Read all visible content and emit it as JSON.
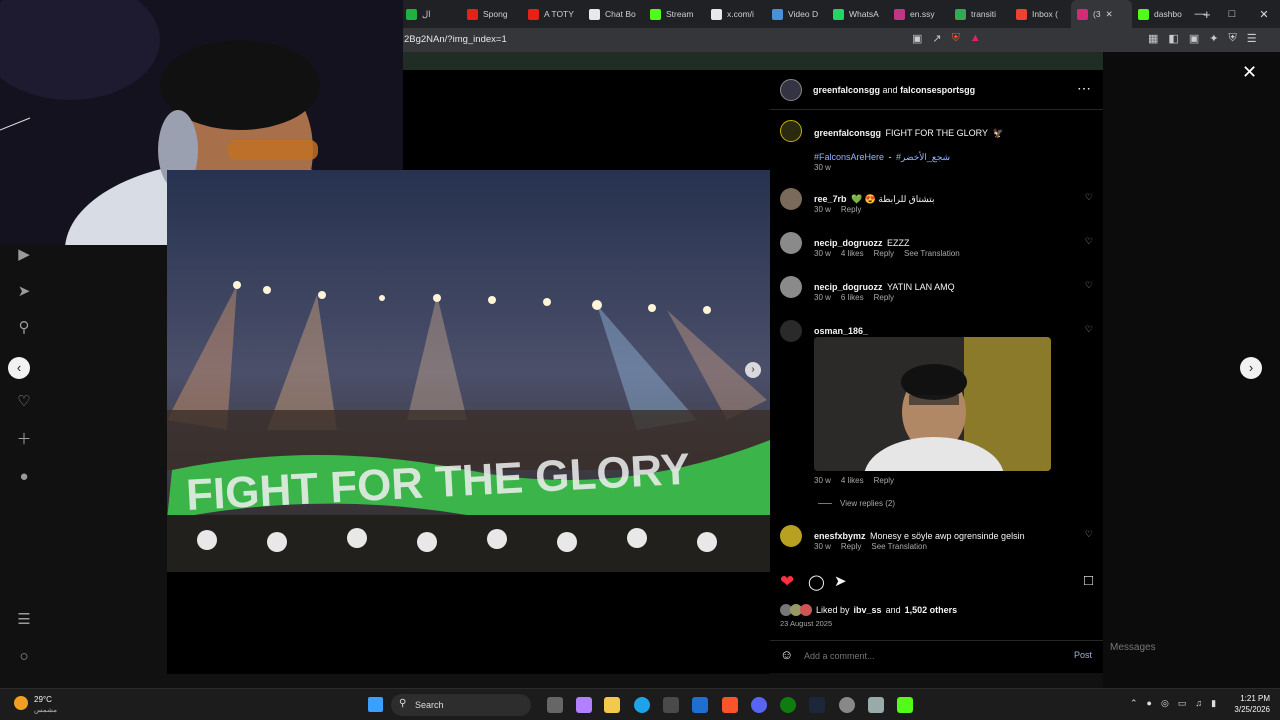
{
  "browser": {
    "tabs": [
      {
        "label": "ال",
        "color": "#1fb141"
      },
      {
        "label": "Spong",
        "color": "#e62117"
      },
      {
        "label": "A TOTY",
        "color": "#e62117"
      },
      {
        "label": "Chat Bo",
        "color": "#e8e8e8"
      },
      {
        "label": "Stream",
        "color": "#53fc18"
      },
      {
        "label": "x.com/i",
        "color": "#e8e8e8"
      },
      {
        "label": "Video D",
        "color": "#4a90d9"
      },
      {
        "label": "WhatsA",
        "color": "#25d366"
      },
      {
        "label": "en.ssy",
        "color": "#c13584"
      },
      {
        "label": "transiti",
        "color": "#34a853"
      },
      {
        "label": "Inbox (",
        "color": "#ea4335"
      },
      {
        "label": "(3",
        "color": "#d62976",
        "active": true
      },
      {
        "label": "dashbo",
        "color": "#53fc18"
      }
    ],
    "new_tab": "+",
    "url": "2Bg2NAn/?img_index=1"
  },
  "post": {
    "header": {
      "user1": "greenfalconsgg",
      "joiner": "and",
      "user2": "falconsesportsgg"
    },
    "caption": {
      "user": "greenfalconsgg",
      "text": "FIGHT FOR THE GLORY",
      "emoji": "🦅",
      "hashtag1": "#FalconsAreHere",
      "dash": "-",
      "hashtag2": "#شجع_الأخضر",
      "time": "30 w"
    },
    "banner_text": "FIGHT FOR THE GLORY",
    "comments": [
      {
        "user": "ree_7rb",
        "text": "💚 😍 بتشتاق للرابطة",
        "time": "30 w",
        "likes": "",
        "reply": "Reply",
        "translate": ""
      },
      {
        "user": "necip_dogruozz",
        "text": "EZZZ",
        "time": "30 w",
        "likes": "4 likes",
        "reply": "Reply",
        "translate": "See Translation"
      },
      {
        "user": "necip_dogruozz",
        "text": "YATIN LAN AMQ",
        "time": "30 w",
        "likes": "6 likes",
        "reply": "Reply",
        "translate": ""
      },
      {
        "user": "osman_186_",
        "text": "",
        "time": "30 w",
        "likes": "4 likes",
        "reply": "Reply",
        "translate": "",
        "view_replies": "View replies (2)"
      },
      {
        "user": "enesfxbymz",
        "text": "Monesy e söyle awp ogrensinde gelsin",
        "time": "30 w",
        "likes": "",
        "reply": "Reply",
        "translate": "See Translation"
      }
    ],
    "liked_by": {
      "prefix": "Liked by",
      "user": "ibv_ss",
      "joiner": "and",
      "others": "1,502 others"
    },
    "date": "23 August 2025",
    "add_comment_placeholder": "Add a comment...",
    "post_button": "Post"
  },
  "messages_label": "Messages",
  "taskbar": {
    "weather_temp": "29°C",
    "weather_desc": "مشمس",
    "search": "Search",
    "time": "1:21 PM",
    "date": "3/25/2026"
  },
  "colors": {
    "heart": "#ff3040",
    "hashtag": "#8fb4ff",
    "panel_bg": "#000000"
  }
}
